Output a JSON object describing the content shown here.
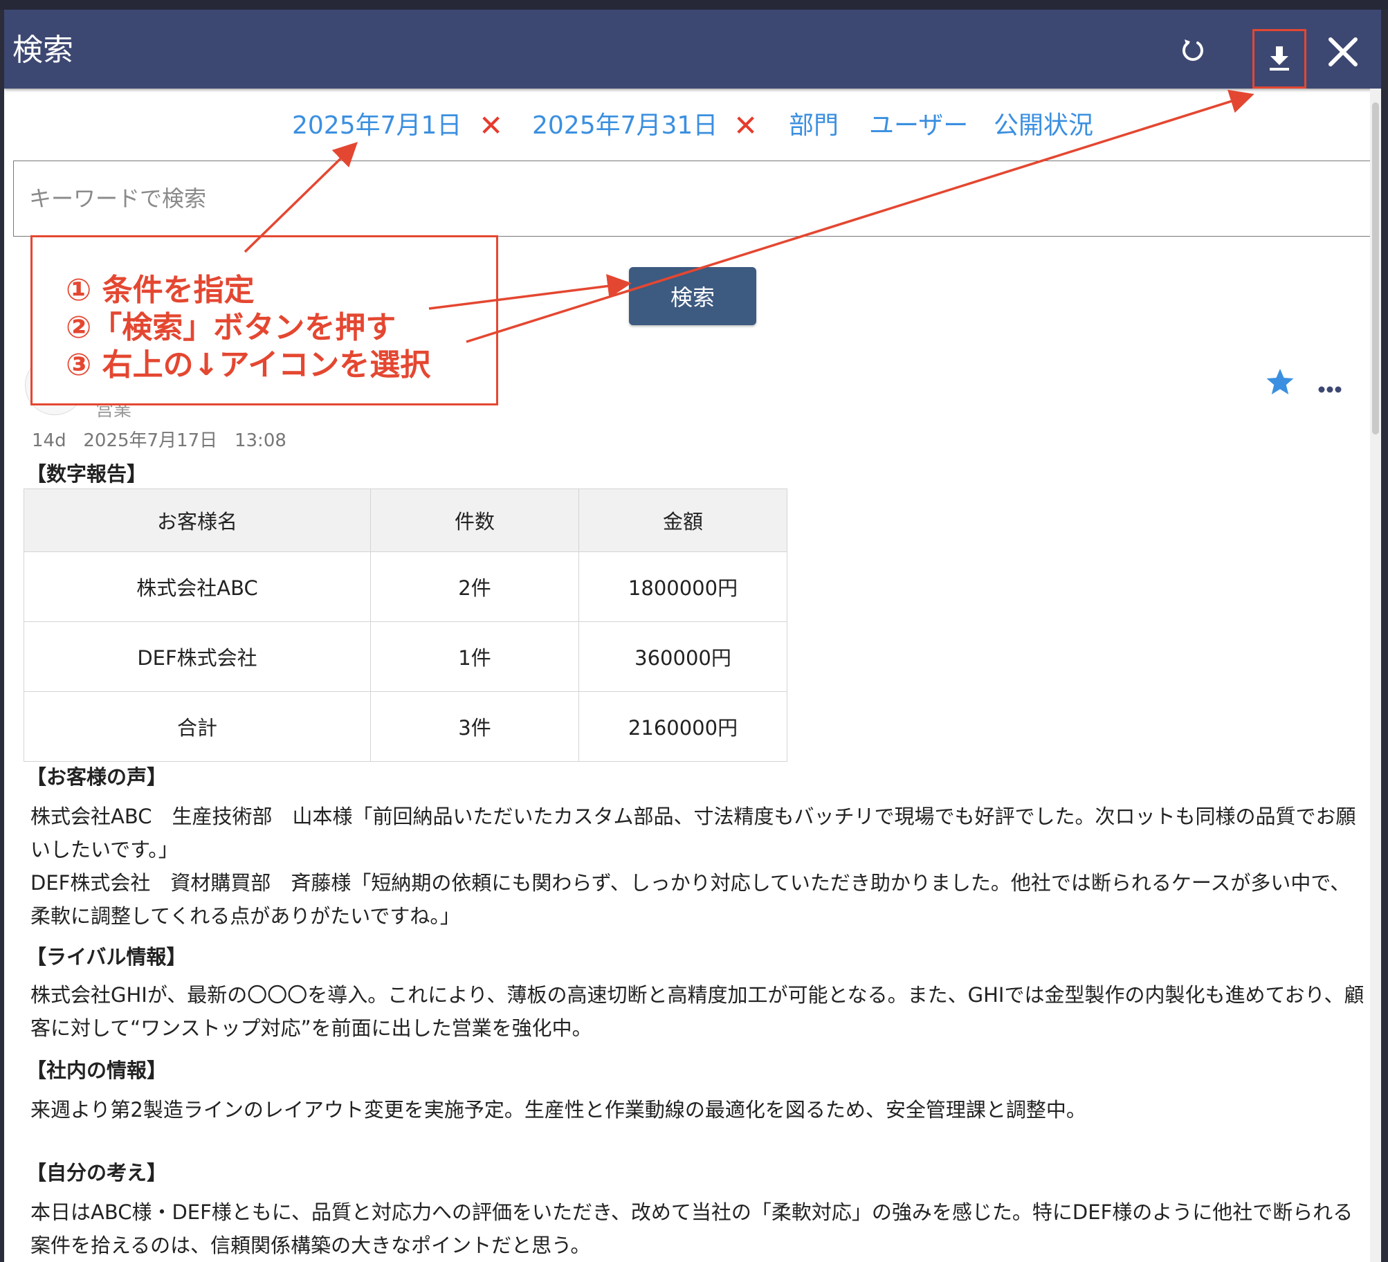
{
  "header": {
    "title": "検索",
    "icons": [
      "refresh-icon",
      "download-icon",
      "close-icon"
    ]
  },
  "filters": {
    "start_date": "2025年7月1日",
    "end_date": "2025年7月31日",
    "clear_symbol": "✕",
    "department": "部門",
    "user": "ユーザー",
    "visibility": "公開状況"
  },
  "search": {
    "placeholder": "キーワードで検索",
    "button_label": "検索"
  },
  "callout": {
    "step1": "① 条件を指定",
    "step2": "②「検索」ボタンを押す",
    "step3": "③ 右上の↓アイコンを選択"
  },
  "post": {
    "dept": "営業",
    "meta": "14d   2025年7月17日   13:08",
    "section_numbers": "【数字報告】",
    "table": {
      "headers": [
        "お客様名",
        "件数",
        "金額"
      ],
      "rows": [
        [
          "株式会社ABC",
          "2件",
          "1800000円"
        ],
        [
          "DEF株式会社",
          "1件",
          "360000円"
        ],
        [
          "合計",
          "3件",
          "2160000円"
        ]
      ]
    },
    "section_voice": "【お客様の声】",
    "voice_1": "株式会社ABC　生産技術部　山本様「前回納品いただいたカスタム部品、寸法精度もバッチリで現場でも好評でした。次ロットも同様の品質でお願いしたいです。」",
    "voice_2": "DEF株式会社　資材購買部　斉藤様「短納期の依頼にも関わらず、しっかり対応していただき助かりました。他社では断られるケースが多い中で、柔軟に調整してくれる点がありがたいですね。」",
    "section_rival": "【ライバル情報】",
    "rival": "株式会社GHIが、最新の〇〇〇を導入。これにより、薄板の高速切断と高精度加工が可能となる。また、GHIでは金型製作の内製化も進めており、顧客に対して“ワンストップ対応”を前面に出した営業を強化中。",
    "section_internal": "【社内の情報】",
    "internal": "来週より第2製造ラインのレイアウト変更を実施予定。生産性と作業動線の最適化を図るため、安全管理課と調整中。",
    "section_opinion": "【自分の考え】",
    "opinion": "本日はABC様・DEF様ともに、品質と対応力への評価をいただき、改めて当社の「柔軟対応」の強みを感じた。特にDEF様のように他社で断られる案件を拾えるのは、信頼関係構築の大きなポイントだと思う。"
  },
  "colors": {
    "header_bg": "#3d4872",
    "link_blue": "#3b8fe0",
    "annotation_red": "#e44731",
    "search_button": "#3d5a80",
    "star": "#3b8fe0"
  }
}
